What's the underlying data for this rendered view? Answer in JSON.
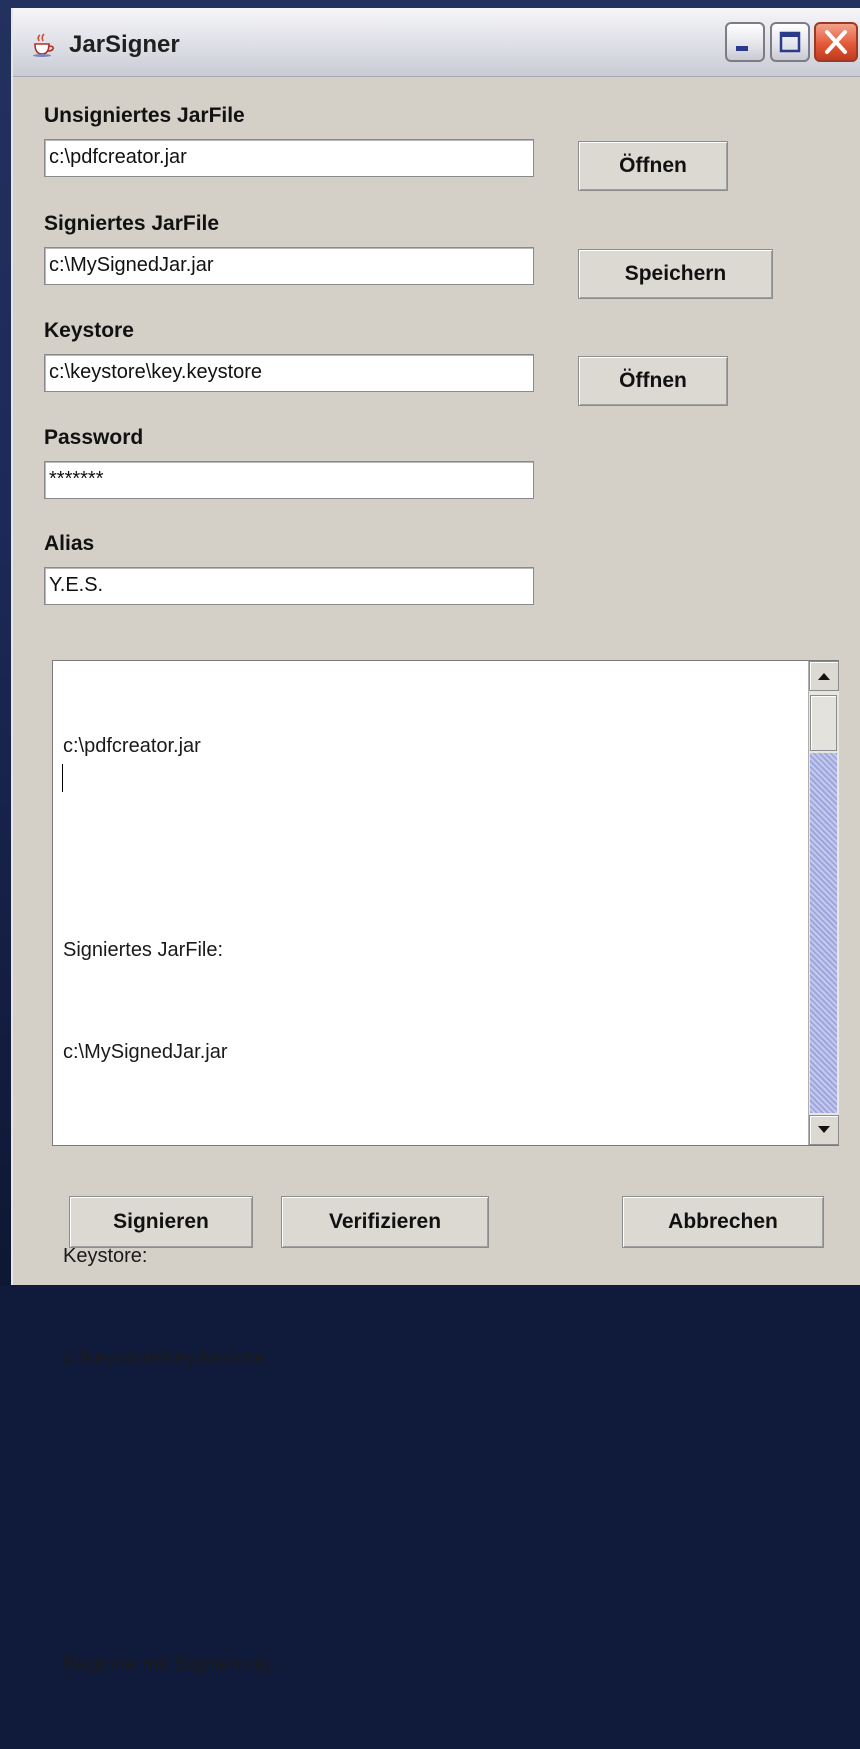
{
  "window": {
    "title": "JarSigner",
    "icon": "java-cup-icon",
    "controls": [
      "minimize-icon",
      "maximize-icon",
      "close-icon"
    ]
  },
  "form": {
    "unsigned": {
      "label": "Unsigniertes JarFile",
      "value": "c:\\pdfcreator.jar",
      "button": "Öffnen"
    },
    "signed": {
      "label": "Signiertes JarFile",
      "value": "c:\\MySignedJar.jar",
      "button": "Speichern"
    },
    "keystore": {
      "label": "Keystore",
      "value": "c:\\keystore\\key.keystore",
      "button": "Öffnen"
    },
    "password": {
      "label": "Password",
      "value": "*******"
    },
    "alias": {
      "label": "Alias",
      "value": "Y.E.S."
    }
  },
  "log": {
    "lines": [
      "c:\\pdfcreator.jar",
      "",
      "Signiertes JarFile:",
      "c:\\MySignedJar.jar",
      "",
      "Keystore:",
      "c:\\keystore\\key.kestore",
      "",
      "",
      "Beginne mit Signierung..."
    ]
  },
  "actions": {
    "sign": "Signieren",
    "verify": "Verifizieren",
    "cancel": "Abbrechen"
  },
  "colors": {
    "window_bg": "#d4d0c8",
    "close_button": "#e45a39",
    "scroll_track": "#9ea6dc"
  }
}
